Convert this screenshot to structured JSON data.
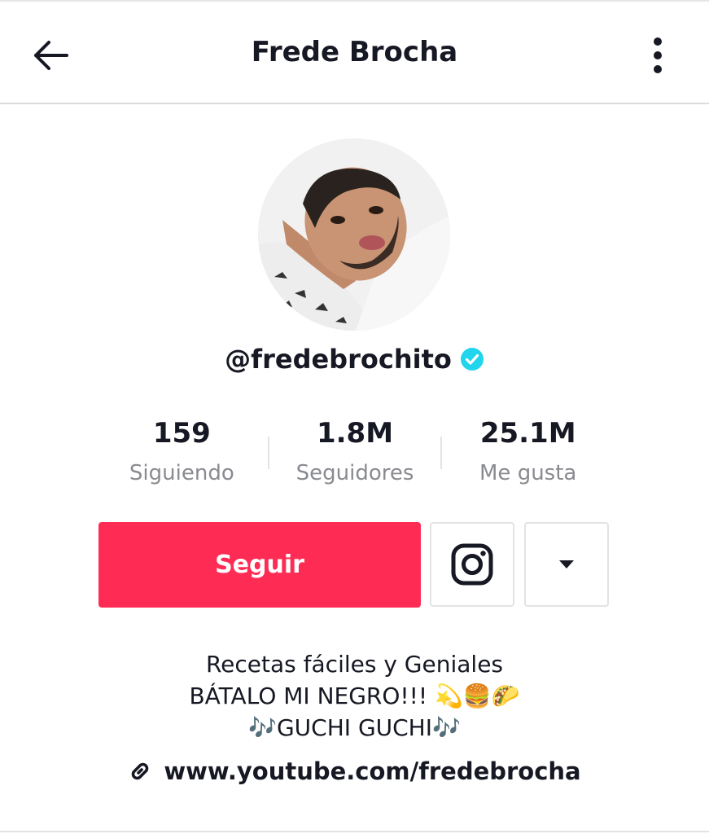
{
  "header": {
    "title": "Frede Brocha",
    "back_icon": "arrow-left-icon",
    "more_icon": "more-vertical-icon"
  },
  "profile": {
    "username": "@fredebrochito",
    "verified_icon": "verified-badge-icon",
    "verified_color": "#20d5ec"
  },
  "stats": [
    {
      "value": "159",
      "label": "Siguiendo"
    },
    {
      "value": "1.8M",
      "label": "Seguidores"
    },
    {
      "value": "25.1M",
      "label": "Me gusta"
    }
  ],
  "actions": {
    "follow_label": "Seguir",
    "follow_color": "#fe2c55",
    "instagram_icon": "instagram-icon",
    "dropdown_icon": "caret-down-icon"
  },
  "bio": {
    "line1": "Recetas fáciles y Geniales",
    "line2": "BÁTALO MI NEGRO!!! 💫🍔🌮",
    "line3": "🎶GUCHI GUCHI🎶"
  },
  "link": {
    "icon": "link-icon",
    "text": "www.youtube.com/fredebrocha"
  }
}
